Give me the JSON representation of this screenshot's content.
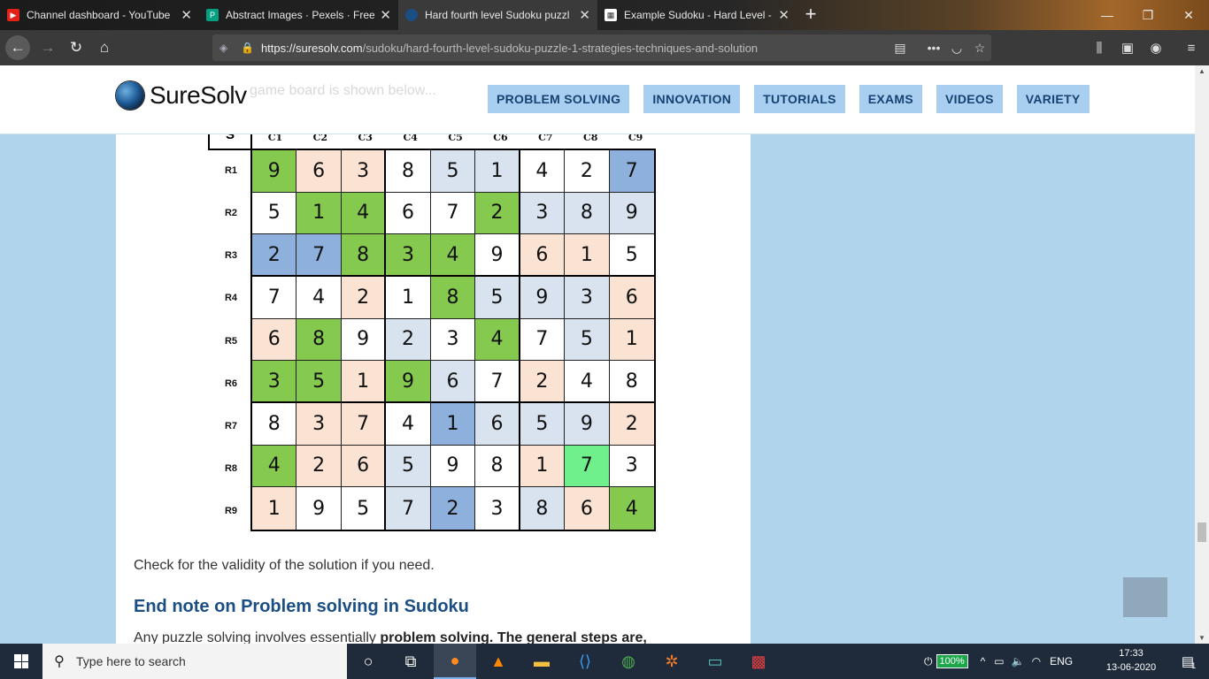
{
  "browser": {
    "tabs": [
      {
        "label": "Channel dashboard - YouTube",
        "icon": "youtube-icon",
        "color": "#e62117"
      },
      {
        "label": "Abstract Images · Pexels · Free",
        "icon": "pexels-icon",
        "color": "#05a081"
      },
      {
        "label": "Hard fourth level Sudoku puzzl",
        "icon": "suresolv-icon",
        "color": "#1b4f83"
      },
      {
        "label": "Example Sudoku - Hard Level -",
        "icon": "grid-icon",
        "color": "#ffffff"
      }
    ],
    "url_host": "https://suresolv.com",
    "url_path": "/sudoku/hard-fourth-level-sudoku-puzzle-1-strategies-techniques-and-solution"
  },
  "site": {
    "brand": "SureSolv",
    "ghost_text": "game board is shown below...",
    "menu": [
      "PROBLEM SOLVING",
      "INNOVATION",
      "TUTORIALS",
      "EXAMS",
      "VIDEOS",
      "VARIETY"
    ]
  },
  "sudoku": {
    "corner": "S",
    "cols": [
      "C1",
      "C2",
      "C3",
      "C4",
      "C5",
      "C6",
      "C7",
      "C8",
      "C9"
    ],
    "rows": [
      "R1",
      "R2",
      "R3",
      "R4",
      "R5",
      "R6",
      "R7",
      "R8",
      "R9"
    ],
    "values": [
      [
        "9",
        "6",
        "3",
        "8",
        "5",
        "1",
        "4",
        "2",
        "7"
      ],
      [
        "5",
        "1",
        "4",
        "6",
        "7",
        "2",
        "3",
        "8",
        "9"
      ],
      [
        "2",
        "7",
        "8",
        "3",
        "4",
        "9",
        "6",
        "1",
        "5"
      ],
      [
        "7",
        "4",
        "2",
        "1",
        "8",
        "5",
        "9",
        "3",
        "6"
      ],
      [
        "6",
        "8",
        "9",
        "2",
        "3",
        "4",
        "7",
        "5",
        "1"
      ],
      [
        "3",
        "5",
        "1",
        "9",
        "6",
        "7",
        "2",
        "4",
        "8"
      ],
      [
        "8",
        "3",
        "7",
        "4",
        "1",
        "6",
        "5",
        "9",
        "2"
      ],
      [
        "4",
        "2",
        "6",
        "5",
        "9",
        "8",
        "1",
        "7",
        "3"
      ],
      [
        "1",
        "9",
        "5",
        "7",
        "2",
        "3",
        "8",
        "6",
        "4"
      ]
    ],
    "shades": [
      [
        "g",
        "p",
        "p",
        "w",
        "l",
        "l",
        "w",
        "w",
        "b"
      ],
      [
        "w",
        "g",
        "g",
        "w",
        "w",
        "g",
        "l",
        "l",
        "l"
      ],
      [
        "b",
        "b",
        "g",
        "g",
        "g",
        "w",
        "p",
        "p",
        "w"
      ],
      [
        "w",
        "w",
        "p",
        "w",
        "g",
        "l",
        "l",
        "l",
        "p"
      ],
      [
        "p",
        "g",
        "w",
        "l",
        "w",
        "g",
        "w",
        "l",
        "p"
      ],
      [
        "g",
        "g",
        "p",
        "g",
        "l",
        "w",
        "p",
        "w",
        "w"
      ],
      [
        "w",
        "p",
        "p",
        "w",
        "b",
        "l",
        "l",
        "l",
        "p"
      ],
      [
        "g",
        "p",
        "p",
        "l",
        "w",
        "w",
        "p",
        "m",
        "w"
      ],
      [
        "p",
        "w",
        "w",
        "l",
        "b",
        "w",
        "l",
        "p",
        "g"
      ]
    ],
    "shade_colors": {
      "w": "#ffffff",
      "g": "#86c94f",
      "p": "#fbe3d3",
      "l": "#d9e3f0",
      "b": "#8eb0dc",
      "m": "#70f08c"
    }
  },
  "article": {
    "paragraph": "Check for the validity of the solution if you need.",
    "heading": "End note on Problem solving in Sudoku",
    "paragraph2_start": "Any puzzle solving involves essentially ",
    "paragraph2_bold": "problem solving. The general steps are,"
  },
  "taskbar": {
    "search_placeholder": "Type here to search",
    "battery": "100%",
    "language": "ENG",
    "time": "17:33",
    "date": "13-06-2020",
    "notification_count": "1"
  }
}
